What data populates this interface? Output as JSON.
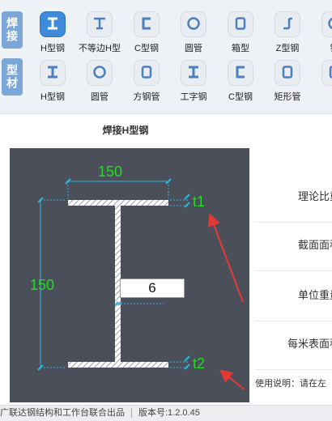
{
  "groups": [
    {
      "label": "焊接"
    },
    {
      "label": "型材"
    }
  ],
  "row1": [
    {
      "label": "H型钢",
      "icon": "h-beam-icon",
      "glyph": "I"
    },
    {
      "label": "不等边H型",
      "icon": "unequal-h-icon",
      "glyph": "T"
    },
    {
      "label": "C型钢",
      "icon": "c-channel-icon",
      "glyph": "C"
    },
    {
      "label": "圆管",
      "icon": "round-tube-icon",
      "glyph": "O"
    },
    {
      "label": "箱型",
      "icon": "box-section-icon",
      "glyph": "box"
    },
    {
      "label": "Z型钢",
      "icon": "z-section-icon",
      "glyph": "Z"
    },
    {
      "label": "钢",
      "icon": "steel-icon",
      "glyph": "O"
    }
  ],
  "row2": [
    {
      "label": "H型钢",
      "icon": "h-beam-icon",
      "glyph": "I"
    },
    {
      "label": "圆管",
      "icon": "round-tube-icon",
      "glyph": "O"
    },
    {
      "label": "方钢管",
      "icon": "square-tube-icon",
      "glyph": "box"
    },
    {
      "label": "工字钢",
      "icon": "i-beam-icon",
      "glyph": "I"
    },
    {
      "label": "C型钢",
      "icon": "c-channel-icon",
      "glyph": "C"
    },
    {
      "label": "矩形管",
      "icon": "rect-tube-icon",
      "glyph": "box"
    },
    {
      "label": "",
      "icon": "partial-icon",
      "glyph": "box"
    }
  ],
  "diagram": {
    "title": "焊接H型钢",
    "width_dim": "150",
    "height_dim": "150",
    "web_thickness": "6",
    "t1_label": "t1",
    "t2_label": "t2"
  },
  "properties": [
    "理论比重",
    "截面面积",
    "单位重量",
    "每米表面积"
  ],
  "usage": "使用说明：请在左",
  "status": {
    "credit": "广联达钢结构和工作台联合出品",
    "version": "版本号:1.2.0.45"
  },
  "colors": {
    "accent": "#3d8bd9",
    "dimension": "#22dd22",
    "diagram_bg": "#4a4f59",
    "arrow": "#e53935"
  }
}
